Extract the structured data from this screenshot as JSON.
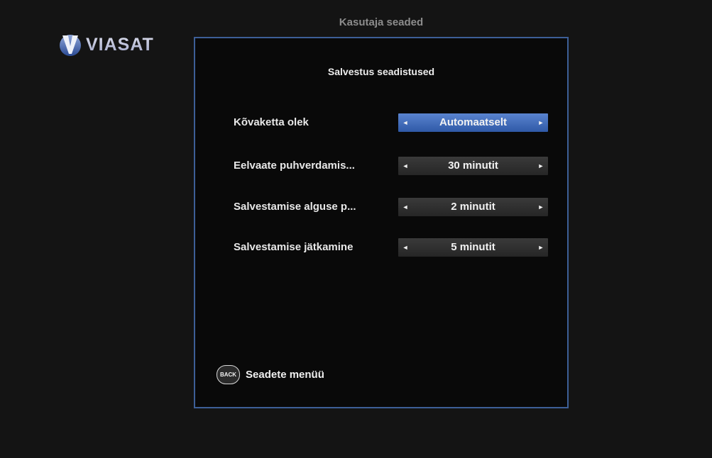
{
  "brand": {
    "logo_text": "VIASAT",
    "logo_icon": "viasat-v-logo-icon"
  },
  "screen_title": "Kasutaja seaded",
  "panel": {
    "title": "Salvestus seadistused",
    "settings": [
      {
        "label": "Kõvaketta olek",
        "value": "Automaatselt",
        "active": true
      },
      {
        "label": "Eelvaate puhverdamis...",
        "value": "30 minutit",
        "active": false
      },
      {
        "label": "Salvestamise alguse p...",
        "value": "2 minutit",
        "active": false
      },
      {
        "label": "Salvestamise jätkamine",
        "value": "5 minutit",
        "active": false
      }
    ],
    "arrows": {
      "left": "◄",
      "right": "►"
    }
  },
  "footer": {
    "back_button_label": "BACK",
    "back_text": "Seadete menüü"
  },
  "colors": {
    "panel_border": "#3d5f97",
    "active_selector": "#4a74c0",
    "inactive_selector": "#303030",
    "background": "#141414"
  }
}
